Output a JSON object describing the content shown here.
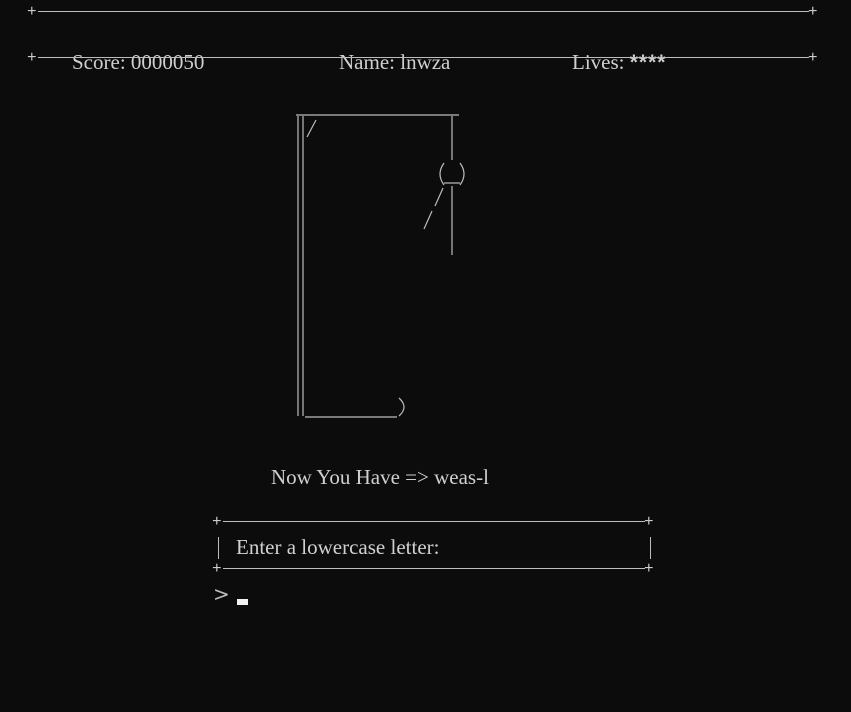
{
  "header": {
    "score_label": "Score:",
    "score_value": "0000050",
    "name_label": "Name:",
    "name_value": "lnwza",
    "lives_label": "Lives:",
    "lives_value": "****"
  },
  "game": {
    "status_prefix": "Now You Have =>",
    "guessed_word": "weas-l"
  },
  "prompt": {
    "message": "Enter a lowercase letter:",
    "prompt_symbol": ">",
    "input_value": ""
  },
  "colors": {
    "background": "#0c0c0c",
    "text": "#cccccc",
    "cursor": "#f2f2f2"
  }
}
